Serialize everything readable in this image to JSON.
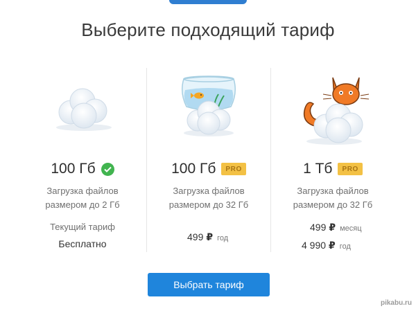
{
  "page": {
    "title": "Выберите подходящий тариф"
  },
  "plans": [
    {
      "size": "100 Гб",
      "badge_icon": "check-icon",
      "description_line1": "Загрузка файлов",
      "description_line2": "размером до 2 Гб",
      "current_label": "Текущий тариф",
      "current_value": "Бесплатно"
    },
    {
      "size": "100 Гб",
      "badge": "PRO",
      "description_line1": "Загрузка файлов",
      "description_line2": "размером до 32 Гб",
      "prices": [
        {
          "amount": "499",
          "currency": "₽",
          "period": "год"
        }
      ]
    },
    {
      "size": "1 Тб",
      "badge": "PRO",
      "description_line1": "Загрузка файлов",
      "description_line2": "размером до 32 Гб",
      "prices": [
        {
          "amount": "499",
          "currency": "₽",
          "period": "месяц"
        },
        {
          "amount": "4 990",
          "currency": "₽",
          "period": "год"
        }
      ]
    }
  ],
  "actions": {
    "choose_label": "Выбрать тариф"
  },
  "watermark": "pikabu.ru",
  "colors": {
    "accent": "#1f85dc",
    "pro_badge": "#f3c145",
    "check": "#41b44f",
    "cat": "#f07a26"
  }
}
